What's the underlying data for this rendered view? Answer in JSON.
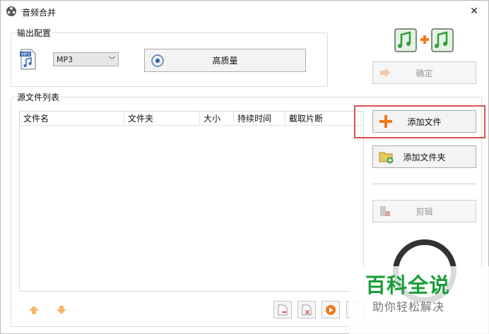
{
  "window": {
    "title": "音频合并",
    "close": "✕"
  },
  "output_config": {
    "group_title": "输出配置",
    "format_value": "MP3",
    "quality_label": "高质量"
  },
  "actions": {
    "ok_label": "确定",
    "add_file_label": "添加文件",
    "add_folder_label": "添加文件夹",
    "clip_label": "剪辑"
  },
  "source_list": {
    "group_title": "源文件列表",
    "columns": [
      "文件名",
      "文件夹",
      "大小",
      "持续时间",
      "截取片断"
    ]
  },
  "watermark": {
    "title": "百科全说",
    "subtitle": "助你轻松解决"
  },
  "colors": {
    "highlight": "#d9534f",
    "watermark_green": "#1a9e3a",
    "add_orange": "#f07a1a"
  }
}
